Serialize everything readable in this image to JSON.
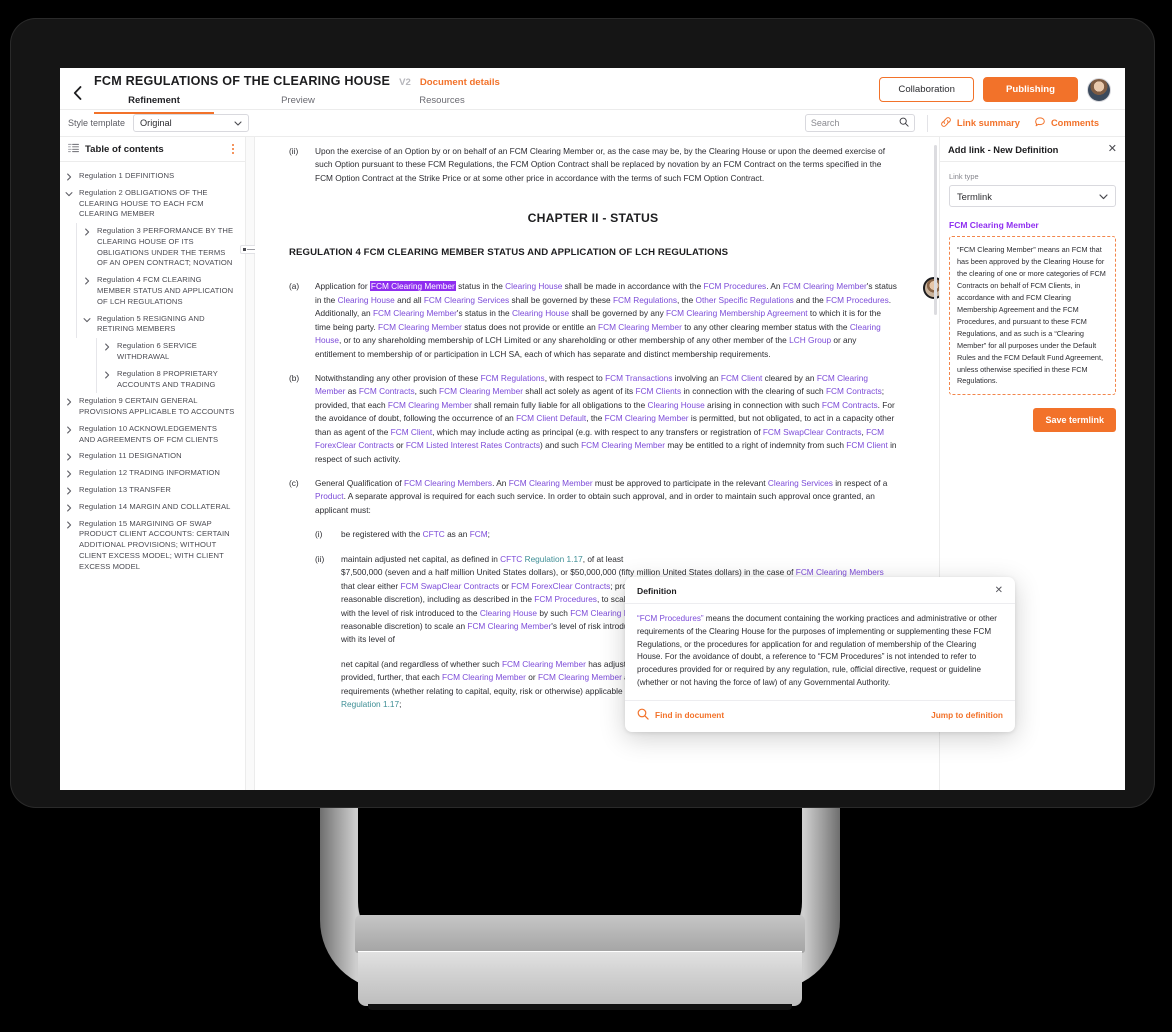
{
  "topbar": {
    "back_icon": "chevron-left-icon",
    "doc_title": "FCM REGULATIONS OF THE CLEARING HOUSE",
    "version": "V2",
    "document_details": "Document details",
    "tabs": [
      {
        "label": "Refinement",
        "active": true
      },
      {
        "label": "Preview",
        "active": false
      },
      {
        "label": "Resources",
        "active": false
      }
    ],
    "collaboration": "Collaboration",
    "publishing": "Publishing",
    "avatar": "user-avatar"
  },
  "subbar": {
    "style_template_label": "Style template",
    "style_template_value": "Original",
    "search_placeholder": "Search",
    "search_value": "",
    "link_summary": "Link summary",
    "comments": "Comments"
  },
  "toc": {
    "title": "Table of contents",
    "items": [
      {
        "level": 0,
        "expanded": false,
        "label": "Regulation 1 DEFINITIONS"
      },
      {
        "level": 0,
        "expanded": true,
        "label": "Regulation 2 OBLIGATIONS OF THE CLEARING HOUSE TO EACH FCM CLEARING MEMBER"
      },
      {
        "level": 1,
        "expanded": false,
        "label": "Regulation 3 PERFORMANCE BY THE CLEARING HOUSE OF ITS OBLIGATIONS UNDER THE TERMS OF AN OPEN CONTRACT; NOVATION"
      },
      {
        "level": 1,
        "expanded": false,
        "label": "Regulation 4 FCM CLEARING MEMBER STATUS AND APPLICATION OF LCH REGULATIONS"
      },
      {
        "level": 1,
        "expanded": true,
        "label": "Regulation 5 RESIGNING AND RETIRING MEMBERS"
      },
      {
        "level": 2,
        "expanded": false,
        "label": "Regulation 6 SERVICE WITHDRAWAL"
      },
      {
        "level": 2,
        "expanded": false,
        "label": "Regulation 8 PROPRIETARY ACCOUNTS AND TRADING"
      },
      {
        "level": 0,
        "expanded": false,
        "label": "Regulation 9 CERTAIN GENERAL PROVISIONS APPLICABLE TO ACCOUNTS"
      },
      {
        "level": 0,
        "expanded": false,
        "label": "Regulation 10 ACKNOWLEDGEMENTS AND AGREEMENTS OF FCM CLIENTS"
      },
      {
        "level": 0,
        "expanded": false,
        "label": "Regulation 11 DESIGNATION"
      },
      {
        "level": 0,
        "expanded": false,
        "label": "Regulation 12 TRADING INFORMATION"
      },
      {
        "level": 0,
        "expanded": false,
        "label": "Regulation 13 TRANSFER"
      },
      {
        "level": 0,
        "expanded": false,
        "label": "Regulation 14 MARGIN AND COLLATERAL"
      },
      {
        "level": 0,
        "expanded": false,
        "label": "Regulation 15 MARGINING OF SWAP PRODUCT CLIENT ACCOUNTS: CERTAIN ADDITIONAL PROVISIONS; WITHOUT CLIENT EXCESS MODEL; WITH CLIENT EXCESS MODEL"
      }
    ]
  },
  "document": {
    "para_ii_top_mark": "(ii)",
    "para_ii_top": "Upon the exercise of an Option by or on behalf of an FCM Clearing Member or, as the case may be, by the Clearing House or upon the deemed exercise of such Option pursuant to these FCM Regulations, the FCM Option Contract shall be replaced by novation by an FCM Contract on the terms specified in the FCM Option Contract at the Strike Price or at some other price in accordance with the terms of such FCM Option Contract.",
    "chapter_heading": "CHAPTER II - STATUS",
    "regulation_heading": "REGULATION 4 FCM CLEARING MEMBER STATUS AND APPLICATION OF LCH REGULATIONS",
    "para_a_mark": "(a)",
    "para_b_mark": "(b)",
    "para_c_mark": "(c)",
    "para_i_mark": "(i)",
    "para_ii_mark": "(ii)",
    "para_i_text": "be registered with the CFTC as an FCM;",
    "highlighted_term": "FCM Clearing Member"
  },
  "definition_popup": {
    "title": "Definition",
    "close_icon": "close-icon",
    "term": "“FCM Procedures”",
    "body": " means the document containing the working practices and administrative or other requirements of the Clearing House for the purposes of implementing or supplementing these FCM Regulations, or the procedures for application for and regulation of membership of the Clearing House. For the avoidance of doubt, a reference to “FCM Procedures” is not intended to refer to procedures provided for or required by any regulation, rule, official directive, request or guideline (whether or not having the force of law) of any Governmental Authority.",
    "find_in_document": "Find in document",
    "jump_to_definition": "Jump to definition"
  },
  "right_panel": {
    "title": "Add link - New Definition",
    "close_icon": "close-icon",
    "link_type_label": "Link type",
    "link_type_value": "Termlink",
    "term": "FCM Clearing Member",
    "definition": "“FCM Clearing Member” means an FCM that has been approved by the Clearing House for the clearing of one or more categories of FCM Contracts on behalf of FCM Clients, in accordance with and FCM Clearing Membership Agreement and the FCM Procedures, and pursuant to these FCM Regulations, and as such is a “Clearing Member” for all purposes under the Default Rules and the FCM Default Fund Agreement, unless otherwise specified in these FCM Regulations.",
    "save_button": "Save termlink"
  },
  "colors": {
    "accent_orange": "#f2722a",
    "termlink_purple": "#7c4bd8",
    "highlight_purple": "#8f2ef0",
    "crosslink_teal": "#3f8f96"
  }
}
